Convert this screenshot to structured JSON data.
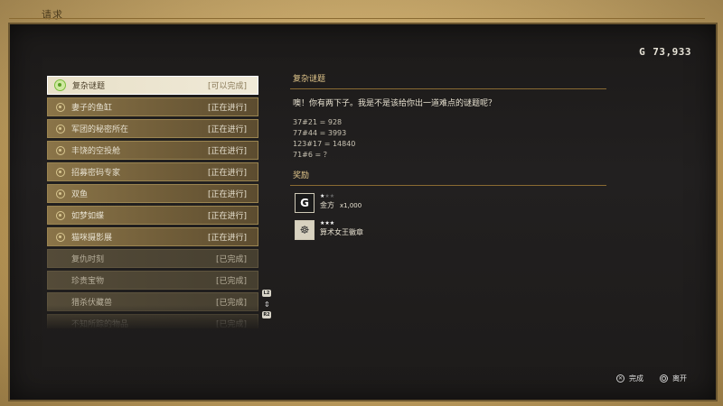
{
  "window": {
    "title": "请求"
  },
  "currency": {
    "icon": "G",
    "amount": "73,933"
  },
  "quests": [
    {
      "name": "复杂谜题",
      "status": "[可以完成]",
      "state": "selected"
    },
    {
      "name": "妻子的鱼缸",
      "status": "[正在进行]",
      "state": "active"
    },
    {
      "name": "军团的秘密所在",
      "status": "[正在进行]",
      "state": "active"
    },
    {
      "name": "丰饶的空投舱",
      "status": "[正在进行]",
      "state": "active"
    },
    {
      "name": "招募密码专家",
      "status": "[正在进行]",
      "state": "active"
    },
    {
      "name": "双鱼",
      "status": "[正在进行]",
      "state": "active"
    },
    {
      "name": "如梦如蝶",
      "status": "[正在进行]",
      "state": "active"
    },
    {
      "name": "猫咪摄影展",
      "status": "[正在进行]",
      "state": "active"
    },
    {
      "name": "复仇时刻",
      "status": "[已完成]",
      "state": "done"
    },
    {
      "name": "珍贵宝物",
      "status": "[已完成]",
      "state": "done"
    },
    {
      "name": "猎杀伏藏兽",
      "status": "[已完成]",
      "state": "done"
    },
    {
      "name": "不知所踪的物品",
      "status": "[已完成]",
      "state": "done"
    }
  ],
  "scroll": {
    "up_label": "L2",
    "down_label": "R2",
    "mid_icon": "up-down-arrows-icon"
  },
  "detail": {
    "title": "复杂谜题",
    "description": "噢！你有两下子。我是不是该给你出一道难点的谜题呢？",
    "puzzle_lines": [
      "37#21 = 928",
      "77#44 = 3993",
      "123#17 = 14840",
      "71#6 = ？"
    ],
    "rewards_title": "奖励",
    "rewards": [
      {
        "icon": "G",
        "icon_name": "gold-coin-icon",
        "stars_filled": 1,
        "stars_total": 3,
        "name": "金方",
        "qty": "x1,000"
      },
      {
        "icon": "☸",
        "icon_name": "badge-icon",
        "stars_filled": 3,
        "stars_total": 3,
        "name": "算术女王徽章",
        "qty": ""
      }
    ]
  },
  "footer": {
    "complete_label": "完成",
    "leave_label": "离开"
  }
}
